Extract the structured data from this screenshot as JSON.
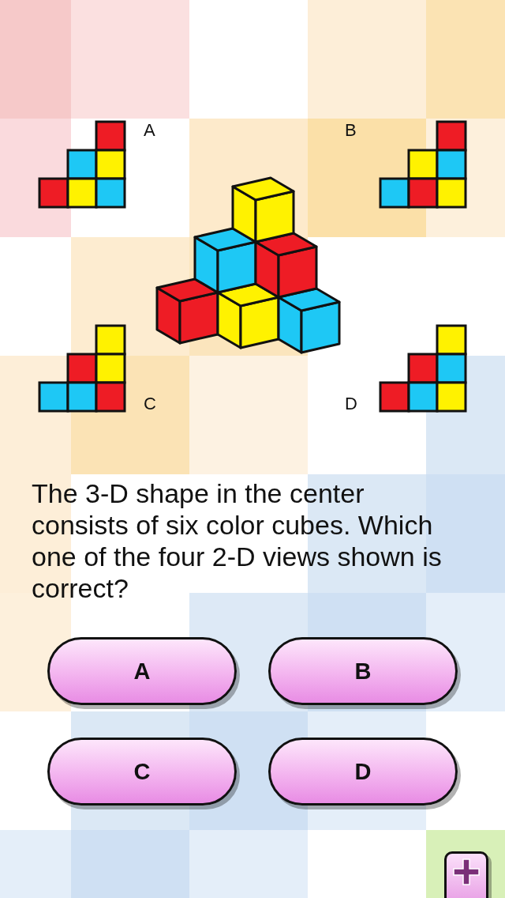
{
  "views": [
    {
      "label": "A",
      "rows": [
        [
          {
            "filled": false
          },
          {
            "filled": false
          },
          {
            "filled": true,
            "color": "#ee1c25"
          }
        ],
        [
          {
            "filled": false
          },
          {
            "filled": true,
            "color": "#1ec8f5"
          },
          {
            "filled": true,
            "color": "#fff200"
          }
        ],
        [
          {
            "filled": true,
            "color": "#ee1c25"
          },
          {
            "filled": true,
            "color": "#fff200"
          },
          {
            "filled": true,
            "color": "#1ec8f5"
          }
        ]
      ]
    },
    {
      "label": "B",
      "rows": [
        [
          {
            "filled": false
          },
          {
            "filled": false
          },
          {
            "filled": true,
            "color": "#ee1c25"
          }
        ],
        [
          {
            "filled": false
          },
          {
            "filled": true,
            "color": "#fff200"
          },
          {
            "filled": true,
            "color": "#1ec8f5"
          }
        ],
        [
          {
            "filled": true,
            "color": "#1ec8f5"
          },
          {
            "filled": true,
            "color": "#ee1c25"
          },
          {
            "filled": true,
            "color": "#fff200"
          }
        ]
      ]
    },
    {
      "label": "C",
      "rows": [
        [
          {
            "filled": false
          },
          {
            "filled": false
          },
          {
            "filled": true,
            "color": "#fff200"
          }
        ],
        [
          {
            "filled": false
          },
          {
            "filled": true,
            "color": "#ee1c25"
          },
          {
            "filled": true,
            "color": "#fff200"
          }
        ],
        [
          {
            "filled": true,
            "color": "#1ec8f5"
          },
          {
            "filled": true,
            "color": "#1ec8f5"
          },
          {
            "filled": true,
            "color": "#ee1c25"
          }
        ]
      ]
    },
    {
      "label": "D",
      "rows": [
        [
          {
            "filled": false
          },
          {
            "filled": false
          },
          {
            "filled": true,
            "color": "#fff200"
          }
        ],
        [
          {
            "filled": false
          },
          {
            "filled": true,
            "color": "#ee1c25"
          },
          {
            "filled": true,
            "color": "#1ec8f5"
          }
        ],
        [
          {
            "filled": true,
            "color": "#ee1c25"
          },
          {
            "filled": true,
            "color": "#1ec8f5"
          },
          {
            "filled": true,
            "color": "#fff200"
          }
        ]
      ]
    }
  ],
  "question": "The 3-D shape in the center consists of six color cubes. Which one of the four 2-D views shown is correct?",
  "answers": [
    "A",
    "B",
    "C",
    "D"
  ]
}
